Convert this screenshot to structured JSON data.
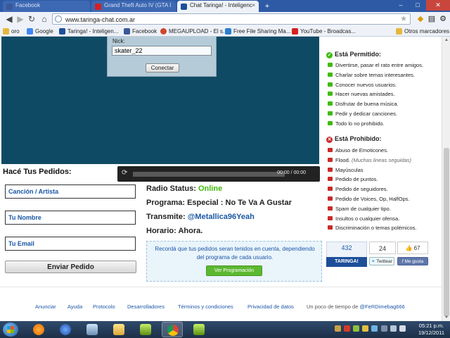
{
  "browser": {
    "tabs": [
      {
        "label": "Facebook",
        "favicon_color": "#3b5998",
        "active": false
      },
      {
        "label": "Grand Theft Auto IV (GTA I",
        "favicon_color": "#d62020",
        "active": false
      },
      {
        "label": "Chat Taringa! - Inteligenc",
        "favicon_color": "#1d4f99",
        "active": true
      }
    ],
    "tab_close_glyph": "×",
    "new_tab_glyph": "+",
    "window_controls": {
      "minimize": "–",
      "maximize": "□",
      "close": "✕"
    },
    "url": "www.taringa-chat.com.ar",
    "bookmarks": [
      {
        "label": "oro",
        "icon_color": "#e6b73e"
      },
      {
        "label": "Google",
        "icon_color": "#4285f4"
      },
      {
        "label": "Taringa! - Inteligen...",
        "icon_color": "#1d4f99"
      },
      {
        "label": "Facebook",
        "icon_color": "#3b5998"
      },
      {
        "label": "MEGAUPLOAD - El s...",
        "icon_color": "#d0462a"
      },
      {
        "label": "Free File Sharing Ma...",
        "icon_color": "#2a7fd0"
      },
      {
        "label": "YouTube - Broadcas...",
        "icon_color": "#d62020"
      },
      {
        "label": "Otros marcadores",
        "icon_color": "#e6b73e"
      }
    ]
  },
  "chat": {
    "nick_label": "Nick:",
    "nick_value": "skater_22",
    "connect_label": "Conectar"
  },
  "player": {
    "play_glyph": "⟳",
    "time": "00:00 / 00:00"
  },
  "requests": {
    "title": "Hacé Tus Pedidos:",
    "song_placeholder": "Canción / Artista",
    "name_placeholder": "Tu Nombre",
    "email_placeholder": "Tu Email",
    "submit_label": "Enviar Pedido"
  },
  "radio": {
    "status_label": "Radio Status:",
    "status_value": "Online",
    "program_label": "Programa:",
    "program_value": "Especial : No Te Va A Gustar",
    "dj_label": "Transmite:",
    "dj_value": "@Metallica96Yeah",
    "schedule_label": "Horario:",
    "schedule_value": "Ahora.",
    "notice": "Recordá que tus pedidos seran tenidos en cuenta, dependiendo del programa de cada usuario.",
    "schedule_button": "Ver Programación"
  },
  "rules": {
    "allowed_title": "Está Permitido:",
    "allowed_color": "#3fba0c",
    "allowed": [
      "Divertirse, pasar el rato entre amigos.",
      "Charlar sobre temas interesantes.",
      "Conocer nuevos usuarios.",
      "Hacer nuevas amistades.",
      "Disfrutar de buena música.",
      "Pedir y dedicar canciones.",
      "Todo lo no prohibido."
    ],
    "forbidden_title": "Está Prohibido:",
    "forbidden_color": "#c92a2a",
    "forbidden": [
      "Abuso de Emoticones.",
      "Flood.",
      "Mayúsculas",
      "Pedido de puntos.",
      "Pedido de seguidores.",
      "Pedido de Voices, Op, HalfOps.",
      "Spam de cualquier tipo.",
      "Insultos o cualquier ofensa.",
      "Discriminación o temas polémicos."
    ],
    "flood_note": "(Muchas lineas seguidas)"
  },
  "social": {
    "share_count": "432",
    "share_brand": "TARINGA!",
    "tweet_count": "24",
    "tweet_label": "Twittear",
    "like_count": "67",
    "like_label": "Me gusta"
  },
  "footer": {
    "links": [
      "Anunciar",
      "Ayuda",
      "Protocolo",
      "Desarrolladores",
      "Términos y condiciones",
      "Privacidad de datos"
    ],
    "credit_text": "Un poco de tiempo de",
    "credit_user": "@FeRDimebag666"
  },
  "taskbar": {
    "time": "05:21 p.m.",
    "date": "19/12/2011"
  }
}
